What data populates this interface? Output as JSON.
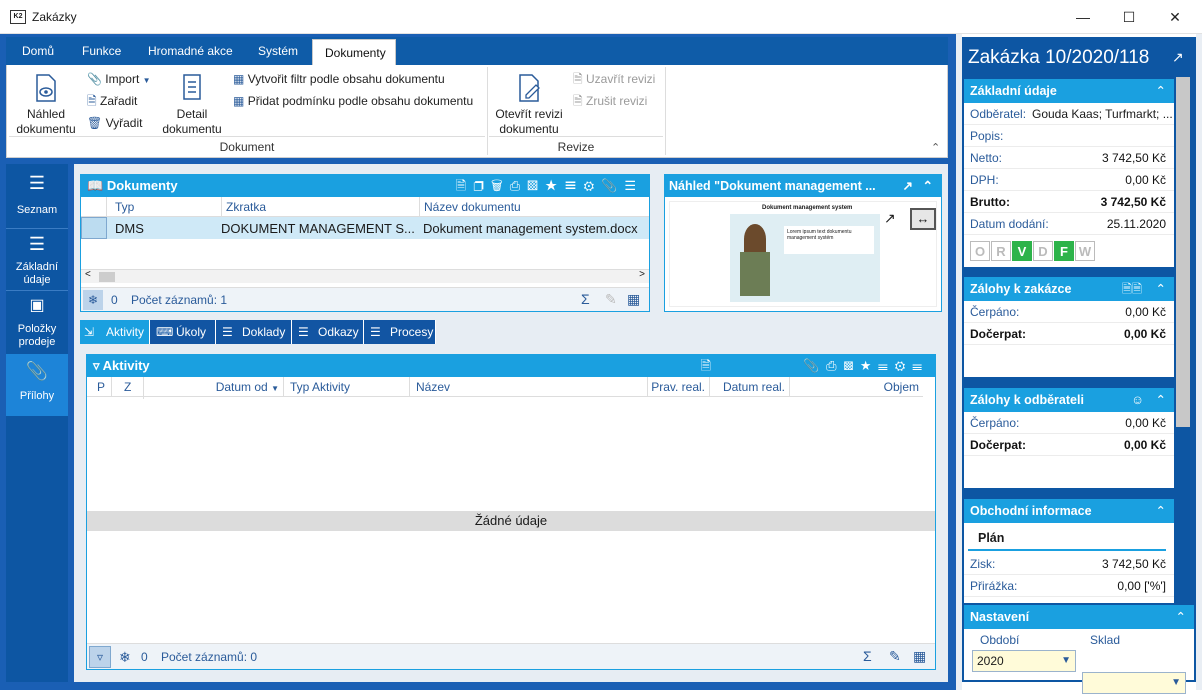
{
  "window": {
    "title": "Zakázky",
    "app_icon": "K2"
  },
  "ribbon": {
    "tabs": [
      "Domů",
      "Funkce",
      "Hromadné akce",
      "Systém",
      "Dokumenty"
    ],
    "active_tab": "Dokumenty",
    "dokument_group": {
      "label": "Dokument",
      "nahled": "Náhled\ndokumentu",
      "import": "Import",
      "zaradit": "Zařadit",
      "vyradit": "Vyřadit",
      "detail": "Detail\ndokumentu",
      "filtr": "Vytvořit filtr podle obsahu dokumentu",
      "podminka": "Přidat podmínku podle obsahu dokumentu"
    },
    "revize_group": {
      "label": "Revize",
      "otevrit": "Otevřít revizi\ndokumentu",
      "uzavrit": "Uzavřít revizi",
      "zrusit": "Zrušit revizi"
    }
  },
  "sidebar": {
    "items": [
      {
        "label": "Seznam"
      },
      {
        "label": "Základní údaje"
      },
      {
        "label": "Položky prodeje"
      },
      {
        "label": "Přílohy"
      }
    ]
  },
  "documents": {
    "title": "Dokumenty",
    "columns": [
      "Typ",
      "Zkratka",
      "Název dokumentu"
    ],
    "rows": [
      {
        "typ": "DMS",
        "zkratka": "DOKUMENT MANAGEMENT S...",
        "nazev": "Dokument management system.docx"
      }
    ],
    "count_badge": "0",
    "footer": "Počet záznamů: 1"
  },
  "preview": {
    "title": "Náhled \"Dokument management ...",
    "doc_heading": "Dokument management system",
    "doc_snippet": "Lorem ipsum text dokumentu management systém"
  },
  "subtabs": [
    "Aktivity",
    "Úkoly",
    "Doklady",
    "Odkazy",
    "Procesy"
  ],
  "activities": {
    "title": "Aktivity",
    "columns": [
      "P",
      "Z",
      "Datum od",
      "Typ Aktivity",
      "Název",
      "Prav. real.",
      "Datum real.",
      "Objem"
    ],
    "empty": "Žádné údaje",
    "count_badge": "0",
    "footer": "Počet záznamů: 0"
  },
  "right": {
    "title": "Zakázka 10/2020/118",
    "basic": {
      "header": "Základní údaje",
      "odberatel_label": "Odběratel:",
      "odberatel_value": "Gouda Kaas; Turfmarkt; ...",
      "popis_label": "Popis:",
      "netto_label": "Netto:",
      "netto_value": "3 742,50 Kč",
      "dph_label": "DPH:",
      "dph_value": "0,00 Kč",
      "brutto_label": "Brutto:",
      "brutto_value": "3 742,50 Kč",
      "datum_label": "Datum dodání:",
      "datum_value": "25.11.2020",
      "statuses": [
        "O",
        "R",
        "V",
        "D",
        "F",
        "W"
      ],
      "active_statuses": [
        "V",
        "F"
      ]
    },
    "zalohy_zakazka": {
      "header": "Zálohy k zakázce",
      "cerpano_label": "Čerpáno:",
      "cerpano_value": "0,00 Kč",
      "docerpat_label": "Dočerpat:",
      "docerpat_value": "0,00 Kč"
    },
    "zalohy_odberatel": {
      "header": "Zálohy k odběrateli",
      "cerpano_label": "Čerpáno:",
      "cerpano_value": "0,00 Kč",
      "docerpat_label": "Dočerpat:",
      "docerpat_value": "0,00 Kč"
    },
    "obchodni": {
      "header": "Obchodní informace",
      "plan": "Plán",
      "zisk_label": "Zisk:",
      "zisk_value": "3 742,50 Kč",
      "prirazka_label": "Přirážka:",
      "prirazka_value": "0,00 ['%']"
    },
    "nastaveni": {
      "header": "Nastavení",
      "obdobi_label": "Období",
      "obdobi_value": "2020",
      "sklad_label": "Sklad",
      "sklad_value": ""
    }
  },
  "colors": {
    "dark_blue": "#0d56a3",
    "light_blue": "#1aa0e0",
    "green": "#2db34a"
  }
}
